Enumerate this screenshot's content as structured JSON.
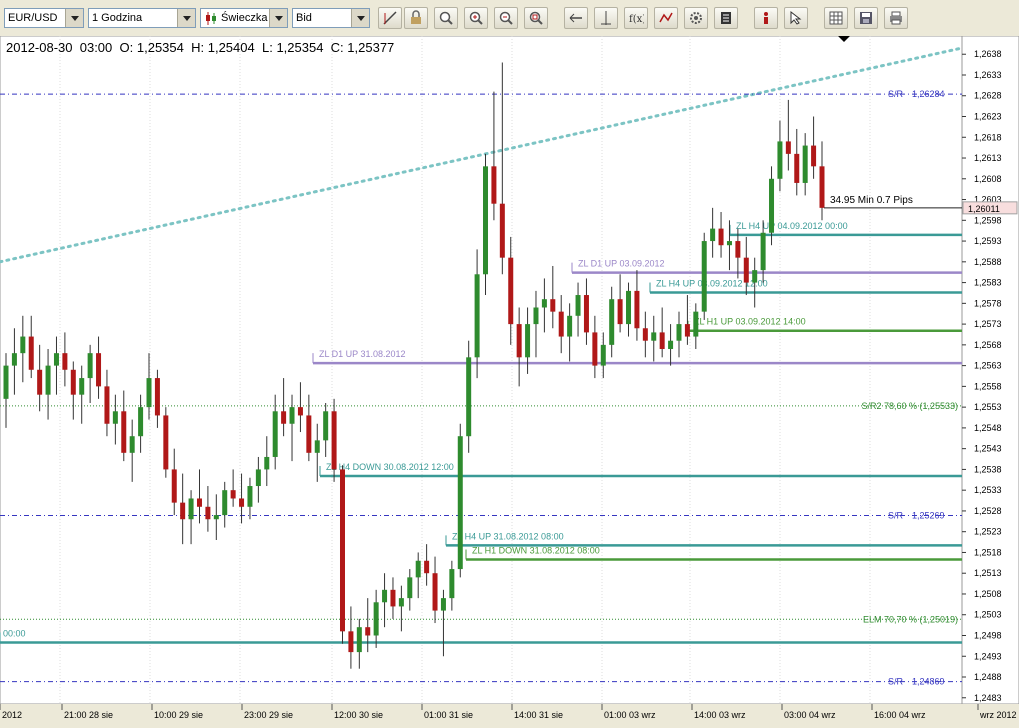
{
  "toolbar": {
    "symbol": "EUR/USD",
    "timeframe": "1 Godzina",
    "chart_type": "Świeczka",
    "price_side": "Bid",
    "icons": [
      "trendline-icon",
      "lock-icon",
      "zoom-fit-icon",
      "zoom-in-icon",
      "zoom-out-icon",
      "zoom-reset-icon",
      "scroll-left-icon",
      "crosshair-icon",
      "indicator-fx-icon",
      "drawing-icon",
      "gear-icon",
      "news-icon",
      "alert-icon",
      "cursor-icon",
      "grid-icon",
      "save-icon",
      "print-icon"
    ]
  },
  "header": {
    "date": "2012-08-30",
    "time": "03:00",
    "o_label": "O:",
    "o": "1,25354",
    "h_label": "H:",
    "h": "1,25404",
    "l_label": "L:",
    "l": "1,25354",
    "c_label": "C:",
    "c": "1,25377"
  },
  "colors": {
    "background": "#ffffff",
    "bull": "#2e8b2e",
    "bear": "#b01818",
    "teal_line": "#3a9a96",
    "green_line": "#4a9a3a",
    "purple_line": "#9b87c8",
    "sr_line": "#3535c0",
    "fib_line": "#2e8b2e",
    "trend_dots": "#7cc4c4"
  },
  "chart_data": {
    "type": "candlestick",
    "ylim": [
      1.24815,
      1.26395
    ],
    "y_ticks": [
      "1,2638",
      "1,2633",
      "1,2628",
      "1,2623",
      "1,2618",
      "1,2613",
      "1,2608",
      "1,2603",
      "1,2598",
      "1,2593",
      "1,2588",
      "1,2583",
      "1,2578",
      "1,2573",
      "1,2568",
      "1,2563",
      "1,2558",
      "1,2553",
      "1,2548",
      "1,2543",
      "1,2538",
      "1,2533",
      "1,2528",
      "1,2523",
      "1,2518",
      "1,2513",
      "1,2508",
      "1,2503",
      "1,2498",
      "1,2493",
      "1,2488",
      "1,2483"
    ],
    "x_labels": [
      "2012",
      "21:00 28 sie",
      "10:00 29 sie",
      "23:00 29 sie",
      "12:00 30 sie",
      "01:00 31 sie",
      "14:00 31 sie",
      "01:00 03 wrz",
      "14:00 03 wrz",
      "03:00 04 wrz",
      "16:00 04 wrz",
      "wrz 2012"
    ],
    "current_price": "1,26011",
    "measure_label": "34.95 Min 0.7 Pips",
    "sr_levels": [
      {
        "label": "S/R",
        "value": 1.26284,
        "value_label": "1,26284"
      },
      {
        "label": "S/R",
        "value": 1.25269,
        "value_label": "1,25269"
      },
      {
        "label": "S/R",
        "value": 1.24869,
        "value_label": "1,24869"
      }
    ],
    "fib_levels": [
      {
        "label": "S/R2 78,60 % (1,25533)",
        "value": 1.25533
      },
      {
        "label": "ELM 70,70 % (1,25019)",
        "value": 1.25019
      }
    ],
    "zone_lines": [
      {
        "label": "ZL D1 UP 31.08.2012",
        "value": 1.25636,
        "color": "purple"
      },
      {
        "label": "ZL D1 UP 03.09.2012",
        "value": 1.25854,
        "color": "purple"
      },
      {
        "label": "ZL H4 UP 04.09.2012 00:00",
        "value": 1.25945,
        "color": "teal"
      },
      {
        "label": "ZL H4 UP 03.09.2012 12:00",
        "value": 1.25806,
        "color": "teal"
      },
      {
        "label": "ZL H1 UP 03.09.2012 14:00",
        "value": 1.25714,
        "color": "green"
      },
      {
        "label": "ZL H4 DOWN 30.08.2012 12:00",
        "value": 1.25364,
        "color": "teal"
      },
      {
        "label": "ZL H4 UP 31.08.2012 08:00",
        "value": 1.25197,
        "color": "teal"
      },
      {
        "label": "ZL H1 DOWN 31.08.2012 08:00",
        "value": 1.25163,
        "color": "green"
      },
      {
        "label": "00:00",
        "value": 1.24963,
        "color": "teal"
      }
    ],
    "trendline": {
      "start": 1.2588,
      "end": 1.26395
    },
    "candles": [
      [
        1.2555,
        1.2566,
        1.2548,
        1.2563
      ],
      [
        1.2563,
        1.2572,
        1.2556,
        1.2566
      ],
      [
        1.2566,
        1.2575,
        1.2559,
        1.257
      ],
      [
        1.257,
        1.2575,
        1.256,
        1.2562
      ],
      [
        1.2562,
        1.2568,
        1.2552,
        1.2556
      ],
      [
        1.2556,
        1.2567,
        1.255,
        1.2563
      ],
      [
        1.2563,
        1.257,
        1.2556,
        1.2566
      ],
      [
        1.2566,
        1.2571,
        1.2558,
        1.2562
      ],
      [
        1.2562,
        1.2564,
        1.255,
        1.2556
      ],
      [
        1.2556,
        1.2563,
        1.2549,
        1.256
      ],
      [
        1.256,
        1.2568,
        1.2554,
        1.2566
      ],
      [
        1.2566,
        1.257,
        1.2555,
        1.2558
      ],
      [
        1.2558,
        1.2562,
        1.2546,
        1.2549
      ],
      [
        1.2549,
        1.2556,
        1.2544,
        1.2552
      ],
      [
        1.2552,
        1.2557,
        1.254,
        1.2542
      ],
      [
        1.2542,
        1.255,
        1.2535,
        1.2546
      ],
      [
        1.2546,
        1.2556,
        1.2542,
        1.2553
      ],
      [
        1.2553,
        1.2566,
        1.255,
        1.256
      ],
      [
        1.256,
        1.2562,
        1.2548,
        1.2551
      ],
      [
        1.2551,
        1.2553,
        1.2536,
        1.2538
      ],
      [
        1.2538,
        1.2543,
        1.2527,
        1.253
      ],
      [
        1.253,
        1.2537,
        1.252,
        1.2526
      ],
      [
        1.2526,
        1.2533,
        1.252,
        1.2531
      ],
      [
        1.2531,
        1.2538,
        1.2525,
        1.2529
      ],
      [
        1.2529,
        1.2534,
        1.2523,
        1.2526
      ],
      [
        1.2526,
        1.2532,
        1.2521,
        1.2527
      ],
      [
        1.2527,
        1.2535,
        1.2524,
        1.2533
      ],
      [
        1.2533,
        1.2538,
        1.2529,
        1.2531
      ],
      [
        1.2531,
        1.2537,
        1.2525,
        1.2529
      ],
      [
        1.2529,
        1.2536,
        1.2526,
        1.2534
      ],
      [
        1.2534,
        1.2541,
        1.253,
        1.2538
      ],
      [
        1.2538,
        1.2546,
        1.2534,
        1.2541
      ],
      [
        1.2541,
        1.2556,
        1.2538,
        1.2552
      ],
      [
        1.2552,
        1.256,
        1.2546,
        1.2549
      ],
      [
        1.2549,
        1.2556,
        1.254,
        1.2553
      ],
      [
        1.2553,
        1.2559,
        1.2547,
        1.2551
      ],
      [
        1.2551,
        1.2556,
        1.254,
        1.2542
      ],
      [
        1.2542,
        1.2549,
        1.2535,
        1.2545
      ],
      [
        1.2545,
        1.2554,
        1.2541,
        1.2552
      ],
      [
        1.2552,
        1.2555,
        1.2535,
        1.2538
      ],
      [
        1.2538,
        1.2539,
        1.2496,
        1.2499
      ],
      [
        1.2499,
        1.2505,
        1.249,
        1.2494
      ],
      [
        1.2494,
        1.2502,
        1.249,
        1.25
      ],
      [
        1.25,
        1.2507,
        1.2494,
        1.2498
      ],
      [
        1.2498,
        1.2509,
        1.2495,
        1.2506
      ],
      [
        1.2506,
        1.2513,
        1.25,
        1.2509
      ],
      [
        1.2509,
        1.2512,
        1.2502,
        1.2505
      ],
      [
        1.2505,
        1.251,
        1.2499,
        1.2507
      ],
      [
        1.2507,
        1.2514,
        1.2504,
        1.2512
      ],
      [
        1.2512,
        1.2518,
        1.2507,
        1.2516
      ],
      [
        1.2516,
        1.252,
        1.251,
        1.2513
      ],
      [
        1.2513,
        1.2517,
        1.2501,
        1.2504
      ],
      [
        1.2504,
        1.2509,
        1.2493,
        1.2507
      ],
      [
        1.2507,
        1.2516,
        1.2504,
        1.2514
      ],
      [
        1.2514,
        1.2549,
        1.2512,
        1.2546
      ],
      [
        1.2546,
        1.2569,
        1.2542,
        1.2565
      ],
      [
        1.2565,
        1.2591,
        1.256,
        1.2585
      ],
      [
        1.2585,
        1.2614,
        1.258,
        1.2611
      ],
      [
        1.2611,
        1.2629,
        1.2598,
        1.2602
      ],
      [
        1.2602,
        1.2636,
        1.2585,
        1.2589
      ],
      [
        1.2589,
        1.2594,
        1.2568,
        1.2573
      ],
      [
        1.2573,
        1.2577,
        1.2558,
        1.2565
      ],
      [
        1.2565,
        1.2577,
        1.2561,
        1.2573
      ],
      [
        1.2573,
        1.2581,
        1.2565,
        1.2577
      ],
      [
        1.2577,
        1.2584,
        1.2571,
        1.2579
      ],
      [
        1.2579,
        1.2587,
        1.2572,
        1.2576
      ],
      [
        1.2576,
        1.258,
        1.2566,
        1.257
      ],
      [
        1.257,
        1.2578,
        1.2564,
        1.2575
      ],
      [
        1.2575,
        1.2583,
        1.257,
        1.258
      ],
      [
        1.258,
        1.2584,
        1.2568,
        1.2571
      ],
      [
        1.2571,
        1.2575,
        1.256,
        1.2563
      ],
      [
        1.2563,
        1.2571,
        1.256,
        1.2568
      ],
      [
        1.2568,
        1.2582,
        1.2565,
        1.2579
      ],
      [
        1.2579,
        1.2585,
        1.2571,
        1.2573
      ],
      [
        1.2573,
        1.2583,
        1.257,
        1.2581
      ],
      [
        1.2581,
        1.2586,
        1.2569,
        1.2572
      ],
      [
        1.2572,
        1.2576,
        1.2565,
        1.2569
      ],
      [
        1.2569,
        1.2575,
        1.2564,
        1.2571
      ],
      [
        1.2571,
        1.2577,
        1.2565,
        1.2567
      ],
      [
        1.2567,
        1.2573,
        1.2563,
        1.2569
      ],
      [
        1.2569,
        1.2576,
        1.2565,
        1.2573
      ],
      [
        1.2573,
        1.258,
        1.2568,
        1.257
      ],
      [
        1.257,
        1.2578,
        1.2567,
        1.2576
      ],
      [
        1.2576,
        1.2595,
        1.2574,
        1.2593
      ],
      [
        1.2593,
        1.2601,
        1.2589,
        1.2596
      ],
      [
        1.2596,
        1.26,
        1.2589,
        1.2592
      ],
      [
        1.2592,
        1.2598,
        1.2586,
        1.2593
      ],
      [
        1.2593,
        1.2596,
        1.2584,
        1.2589
      ],
      [
        1.2589,
        1.2594,
        1.258,
        1.2583
      ],
      [
        1.2583,
        1.2589,
        1.2577,
        1.2586
      ],
      [
        1.2586,
        1.2598,
        1.2583,
        1.2595
      ],
      [
        1.2595,
        1.2611,
        1.2592,
        1.2608
      ],
      [
        1.2608,
        1.2622,
        1.2605,
        1.2617
      ],
      [
        1.2617,
        1.2627,
        1.261,
        1.2614
      ],
      [
        1.2614,
        1.262,
        1.2604,
        1.2607
      ],
      [
        1.2607,
        1.2619,
        1.2604,
        1.2616
      ],
      [
        1.2616,
        1.2623,
        1.2608,
        1.2611
      ],
      [
        1.2611,
        1.2617,
        1.2598,
        1.2601
      ]
    ]
  }
}
